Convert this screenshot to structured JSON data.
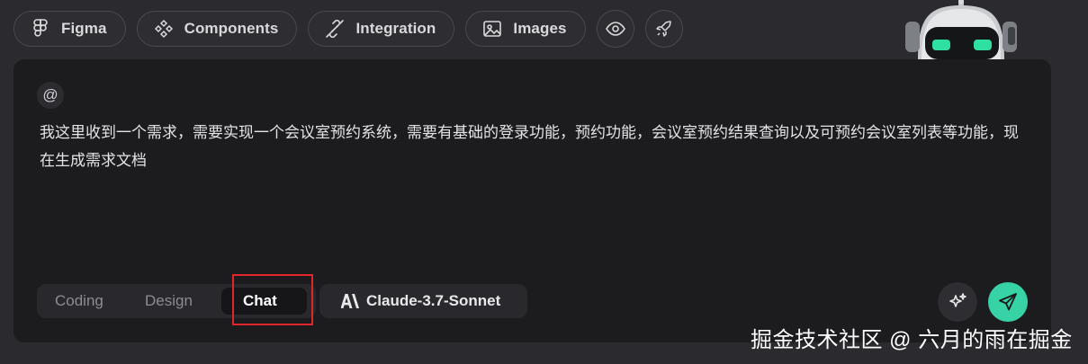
{
  "toolbar": {
    "items": [
      {
        "label": "Figma",
        "icon": "figma-icon"
      },
      {
        "label": "Components",
        "icon": "components-icon"
      },
      {
        "label": "Integration",
        "icon": "plug-icon"
      },
      {
        "label": "Images",
        "icon": "image-icon"
      }
    ],
    "extra_icons": [
      "eye-icon",
      "rocket-icon"
    ]
  },
  "mascot": {
    "icon": "robot-mascot"
  },
  "composer": {
    "mention_symbol": "@",
    "prompt_text": "我这里收到一个需求，需要实现一个会议室预约系统，需要有基础的登录功能，预约功能，会议室预约结果查询以及可预约会议室列表等功能，现在生成需求文档",
    "modes": [
      "Coding",
      "Design",
      "Chat"
    ],
    "active_mode": "Chat",
    "model": {
      "label": "Claude-3.7-Sonnet",
      "icon": "anthropic-icon"
    },
    "actions": [
      "sparkle-icon",
      "send-icon"
    ]
  },
  "colors": {
    "background": "#2b2a2e",
    "panel": "#1c1b1e",
    "accent": "#37d3a6",
    "highlight": "#e0262b"
  },
  "watermark": "掘金技术社区 @ 六月的雨在掘金"
}
